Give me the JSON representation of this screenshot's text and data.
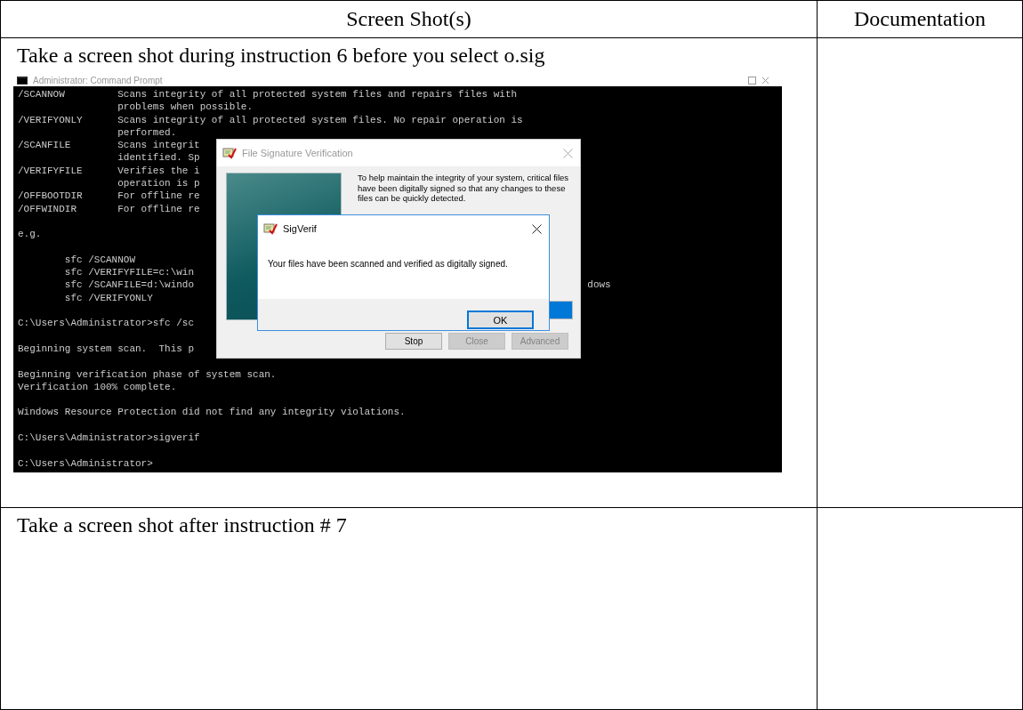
{
  "table": {
    "columns": [
      "Screen Shot(s)",
      "Documentation"
    ],
    "rows": [
      {
        "instruction": "Take a screen shot during instruction 6 before you select o.sig",
        "screenshot": {
          "console": {
            "title": "Administrator: Command Prompt",
            "blocks": [
              [
                {
                  "text": "/SCANNOW         Scans integrity of all protected system files and repairs files with"
                },
                {
                  "text": "                 problems when possible."
                },
                {
                  "text": "/VERIFYONLY      Scans integrity of all protected system files. No repair operation is"
                },
                {
                  "text": "                 performed."
                },
                {
                  "text": "/SCANFILE        Scans integrit"
                },
                {
                  "text": "                 identified. Sp"
                },
                {
                  "text": "/VERIFYFILE      Verifies the i"
                },
                {
                  "text": "                 operation is p"
                },
                {
                  "text": "/OFFBOOTDIR      For offline re"
                },
                {
                  "text": "/OFFWINDIR       For offline re"
                }
              ],
              [
                {
                  "text": "e.g."
                }
              ],
              [
                {
                  "text": "        sfc /SCANNOW"
                },
                {
                  "text": "        sfc /VERIFYFILE=c:\\win"
                },
                {
                  "text": "        sfc /SCANFILE=d:\\windo",
                  "tail": "dows"
                },
                {
                  "text": "        sfc /VERIFYONLY"
                }
              ],
              [
                {
                  "text": "C:\\Users\\Administrator>sfc /sc"
                }
              ],
              [
                {
                  "text": "Beginning system scan.  This p"
                }
              ],
              [
                {
                  "text": "Beginning verification phase of system scan."
                },
                {
                  "text": "Verification 100% complete."
                }
              ],
              [
                {
                  "text": "Windows Resource Protection did not find any integrity violations."
                }
              ],
              [
                {
                  "text": "C:\\Users\\Administrator>sigverif"
                }
              ],
              [
                {
                  "text": "C:\\Users\\Administrator>"
                }
              ]
            ]
          },
          "main_dialog": {
            "title": "File Signature Verification",
            "description": "To help maintain the integrity of your system, critical files have been digitally signed so that any changes to these files can be quickly detected.",
            "progress": {
              "level": 1
            },
            "buttons": [
              {
                "label": "Stop",
                "disabled": false
              },
              {
                "label": "Close",
                "disabled": true
              },
              {
                "label": "Advanced",
                "disabled": true
              }
            ]
          },
          "message_dialog": {
            "title": "SigVerif",
            "message": "Your files have been scanned and verified as digitally signed.",
            "button": "OK"
          }
        }
      },
      {
        "instruction": "Take a screen shot after instruction # 7"
      }
    ]
  }
}
